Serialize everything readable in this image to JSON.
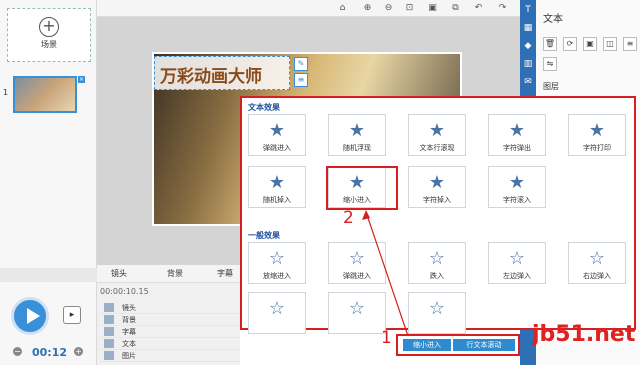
{
  "scene_panel": {
    "add_label": "场景",
    "scene_number": "1"
  },
  "toolbar": {
    "icons": [
      "home-icon",
      "zoom-in-icon",
      "zoom-out-icon",
      "zoom-fit-icon",
      "lock-icon",
      "undo-icon",
      "redo-icon",
      "copy-icon"
    ]
  },
  "canvas": {
    "title_text": "万彩动画大师"
  },
  "right_panel": {
    "title": "文本",
    "sub_label": "图层"
  },
  "timeline": {
    "tabs": [
      "镜头",
      "背景",
      "字幕"
    ],
    "time_display": "00:00:10.15",
    "rows": [
      "镜头",
      "背景",
      "字幕",
      "文本",
      "图片"
    ]
  },
  "playback": {
    "time": "00:12"
  },
  "effects": {
    "text_section_title": "文本效果",
    "general_section_title": "一般效果",
    "text_effects": [
      "弹跳进入",
      "随机浮现",
      "文本行滚现",
      "字符弹出",
      "字符打印",
      "随机掉入",
      "缩小进入",
      "字符掉入",
      "字符滚入"
    ],
    "general_effects": [
      "放缩进入",
      "弹跳进入",
      "跌入",
      "左边弹入",
      "右边弹入",
      "",
      "",
      ""
    ],
    "selected_effect": "缩小进入"
  },
  "annotations": {
    "step1": "1",
    "step2": "2"
  },
  "clips": {
    "clip1": "缩小进入",
    "clip2": "行文本滚动"
  },
  "watermark": {
    "text": "jb51.net"
  }
}
